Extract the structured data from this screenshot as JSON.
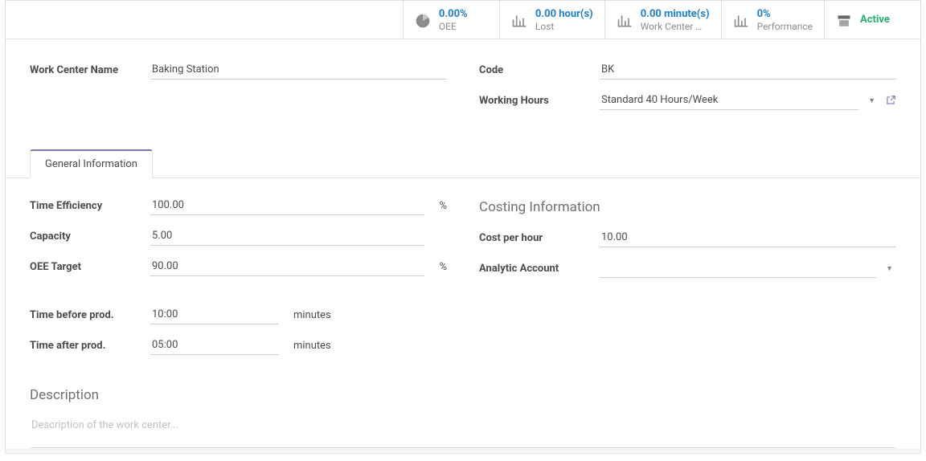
{
  "stats": {
    "oee": {
      "value": "0.00%",
      "label": "OEE"
    },
    "lost": {
      "value": "0.00 hour(s)",
      "label": "Lost"
    },
    "load": {
      "value": "0.00 minute(s)",
      "label": "Work Center …"
    },
    "perf": {
      "value": "0%",
      "label": "Performance"
    },
    "active": {
      "value": "Active",
      "label": ""
    }
  },
  "header": {
    "name_label": "Work Center Name",
    "name_value": "Baking Station",
    "code_label": "Code",
    "code_value": "BK",
    "hours_label": "Working Hours",
    "hours_value": "Standard 40 Hours/Week"
  },
  "tabs": {
    "general": "General Information"
  },
  "general": {
    "time_efficiency_label": "Time Efficiency",
    "time_efficiency_value": "100.00",
    "time_efficiency_unit": "%",
    "capacity_label": "Capacity",
    "capacity_value": "5.00",
    "oee_target_label": "OEE Target",
    "oee_target_value": "90.00",
    "oee_target_unit": "%",
    "time_before_label": "Time before prod.",
    "time_before_value": "10:00",
    "time_before_unit": "minutes",
    "time_after_label": "Time after prod.",
    "time_after_value": "05:00",
    "time_after_unit": "minutes"
  },
  "costing": {
    "title": "Costing Information",
    "cost_per_hour_label": "Cost per hour",
    "cost_per_hour_value": "10.00",
    "analytic_label": "Analytic Account",
    "analytic_value": ""
  },
  "description": {
    "title": "Description",
    "placeholder": "Description of the work center..."
  }
}
